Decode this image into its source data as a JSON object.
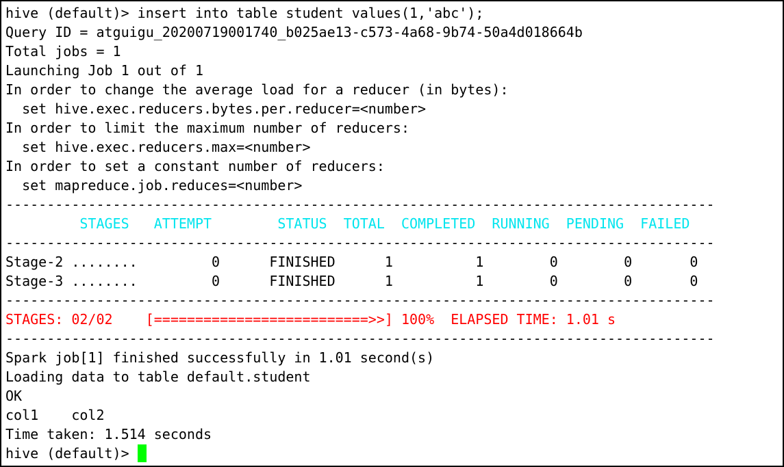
{
  "terminal": {
    "text_color": "#000000",
    "header_color": "#00e5ee",
    "progress_color": "#ff0000",
    "cursor_color": "#00ff00",
    "lines": [
      "hive (default)> insert into table student values(1,'abc');",
      "Query ID = atguigu_20200719001740_b025ae13-c573-4a68-9b74-50a4d018664b",
      "Total jobs = 1",
      "Launching Job 1 out of 1",
      "In order to change the average load for a reducer (in bytes):",
      "  set hive.exec.reducers.bytes.per.reducer=<number>",
      "In order to limit the maximum number of reducers:",
      "  set hive.exec.reducers.max=<number>",
      "In order to set a constant number of reducers:",
      "  set mapreduce.job.reduces=<number>"
    ],
    "separator": "--------------------------------------------------------------------------------------",
    "stage_header": "         STAGES   ATTEMPT        STATUS  TOTAL  COMPLETED  RUNNING  PENDING  FAILED",
    "stage_rows": [
      "Stage-2 ........         0      FINISHED      1          1        0        0       0",
      "Stage-3 ........         0      FINISHED      1          1        0        0       0"
    ],
    "progress_line": "STAGES: 02/02    [==========================>>] 100%  ELAPSED TIME: 1.01 s",
    "tail_lines": [
      "Spark job[1] finished successfully in 1.01 second(s)",
      "Loading data to table default.student",
      "OK",
      "col1    col2",
      "Time taken: 1.514 seconds"
    ],
    "prompt": "hive (default)> "
  }
}
